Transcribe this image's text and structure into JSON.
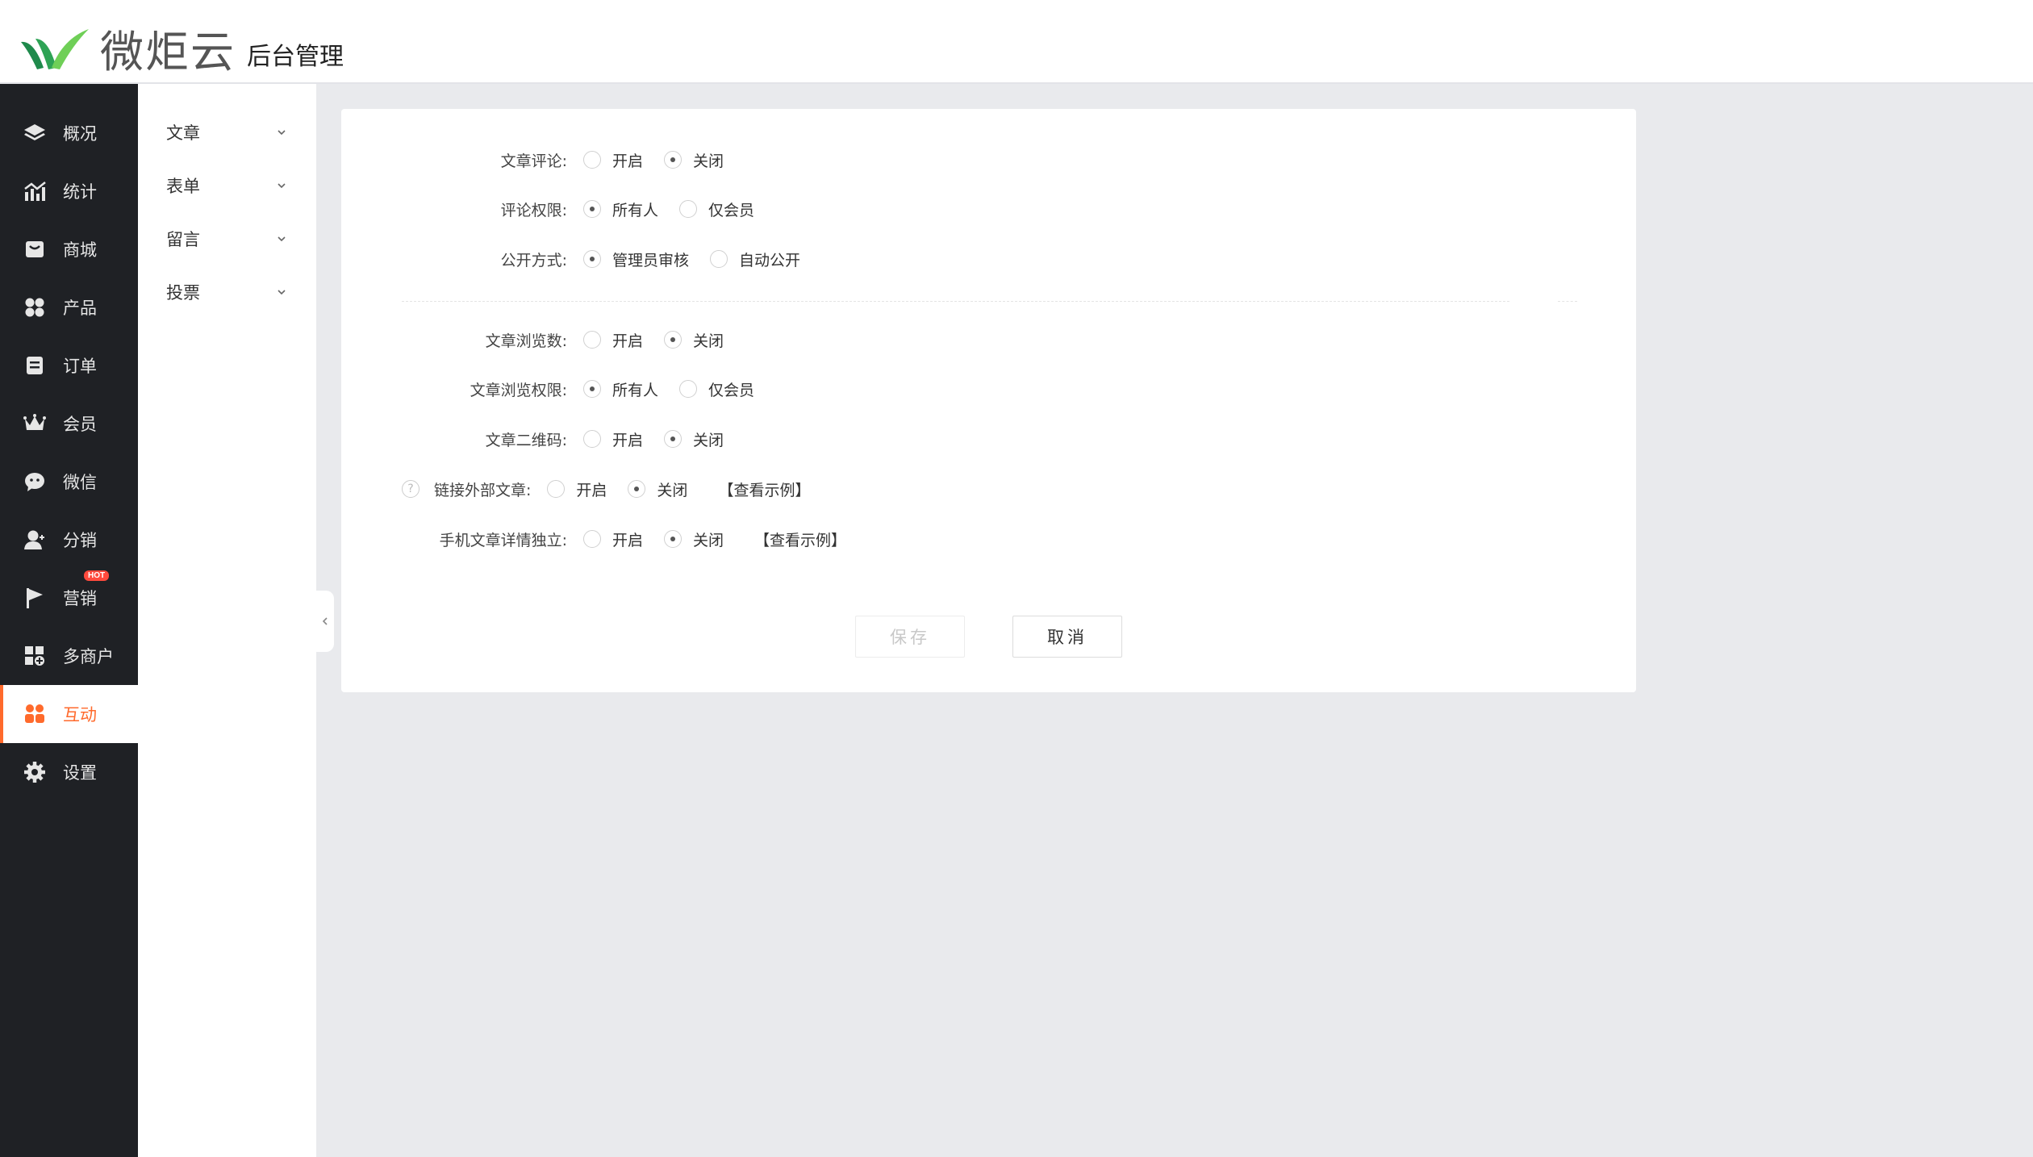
{
  "header": {
    "brand_name": "微炬云",
    "brand_sub": "后台管理",
    "brand_colors": {
      "leaf_dark": "#1f8a4c",
      "leaf_light": "#6fcf57"
    }
  },
  "sidebar": {
    "items": [
      {
        "label": "概况",
        "icon": "layers-icon"
      },
      {
        "label": "统计",
        "icon": "chart-icon"
      },
      {
        "label": "商城",
        "icon": "shop-icon"
      },
      {
        "label": "产品",
        "icon": "grid-icon"
      },
      {
        "label": "订单",
        "icon": "order-icon"
      },
      {
        "label": "会员",
        "icon": "crown-icon"
      },
      {
        "label": "微信",
        "icon": "wechat-icon"
      },
      {
        "label": "分销",
        "icon": "user-icon"
      },
      {
        "label": "营销",
        "icon": "flag-icon",
        "badge": "HOT"
      },
      {
        "label": "多商户",
        "icon": "multi-store-icon"
      },
      {
        "label": "互动",
        "icon": "people-icon",
        "active": true
      },
      {
        "label": "设置",
        "icon": "gear-icon"
      }
    ],
    "active_color": "#ff6a2c"
  },
  "submenu": {
    "items": [
      {
        "label": "文章"
      },
      {
        "label": "表单"
      },
      {
        "label": "留言"
      },
      {
        "label": "投票"
      }
    ]
  },
  "form": {
    "article_comment": {
      "label": "文章评论:",
      "options": [
        "开启",
        "关闭"
      ],
      "selected": 1
    },
    "comment_permission": {
      "label": "评论权限:",
      "options": [
        "所有人",
        "仅会员"
      ],
      "selected": 0
    },
    "publish_mode": {
      "label": "公开方式:",
      "options": [
        "管理员审核",
        "自动公开"
      ],
      "selected": 0
    },
    "view_count": {
      "label": "文章浏览数:",
      "options": [
        "开启",
        "关闭"
      ],
      "selected": 1
    },
    "view_permission": {
      "label": "文章浏览权限:",
      "options": [
        "所有人",
        "仅会员"
      ],
      "selected": 0
    },
    "qr_code": {
      "label": "文章二维码:",
      "options": [
        "开启",
        "关闭"
      ],
      "selected": 1
    },
    "external_link": {
      "label": "链接外部文章:",
      "options": [
        "开启",
        "关闭"
      ],
      "selected": 1,
      "example": "【查看示例】",
      "help": "?"
    },
    "mobile_detail": {
      "label": "手机文章详情独立:",
      "options": [
        "开启",
        "关闭"
      ],
      "selected": 1,
      "example": "【查看示例】"
    }
  },
  "buttons": {
    "save": "保存",
    "cancel": "取消"
  }
}
